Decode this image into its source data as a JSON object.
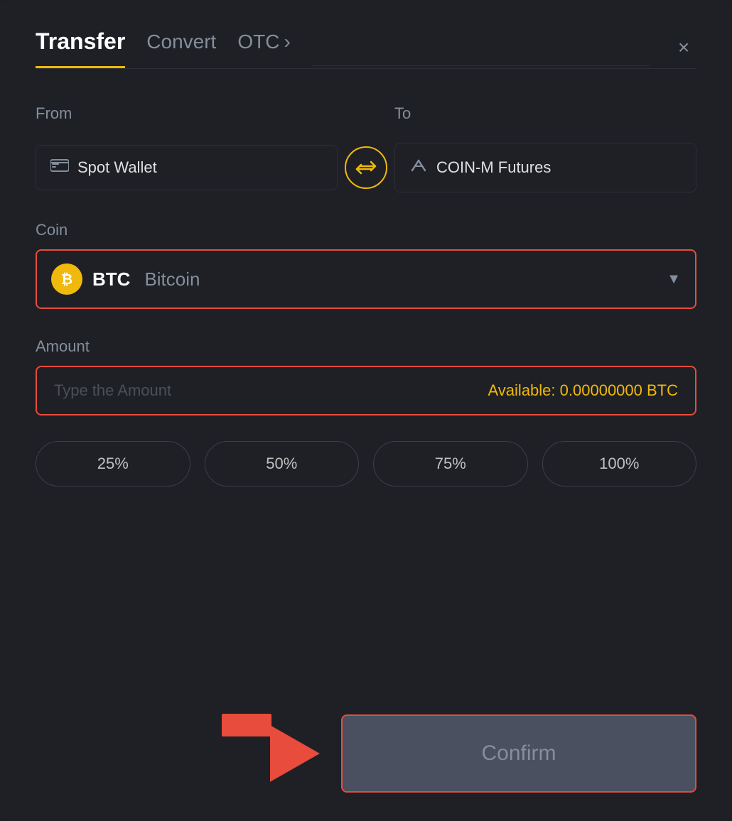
{
  "header": {
    "tab_transfer": "Transfer",
    "tab_convert": "Convert",
    "tab_otc": "OTC",
    "tab_otc_chevron": "›",
    "close_label": "×"
  },
  "from": {
    "label": "From",
    "wallet_icon": "▬",
    "wallet_name": "Spot Wallet"
  },
  "to": {
    "label": "To",
    "wallet_icon": "↑",
    "wallet_name": "COIN-M Futures"
  },
  "swap": {
    "icon": "⇄"
  },
  "coin": {
    "label": "Coin",
    "symbol": "BTC",
    "name": "Bitcoin",
    "btc_symbol": "₿"
  },
  "amount": {
    "label": "Amount",
    "placeholder": "Type the Amount",
    "available_label": "Available:",
    "available_value": "0.00000000 BTC"
  },
  "percentages": [
    {
      "label": "25%"
    },
    {
      "label": "50%"
    },
    {
      "label": "75%"
    },
    {
      "label": "100%"
    }
  ],
  "confirm": {
    "label": "Confirm"
  }
}
